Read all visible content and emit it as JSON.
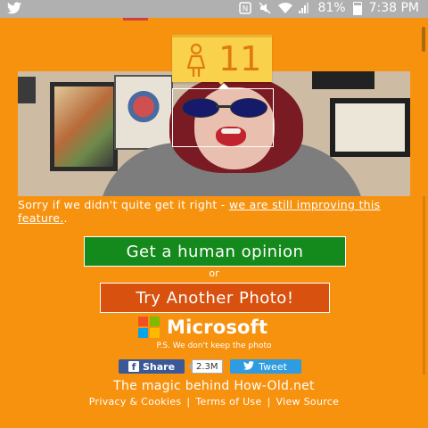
{
  "status_bar": {
    "icons": [
      "twitter-icon",
      "nfc-icon",
      "mute-icon",
      "wifi-icon",
      "signal-icon",
      "battery-icon"
    ],
    "battery_percent": "81%",
    "time": "7:38 PM"
  },
  "age_badge": {
    "gender_icon": "female-icon",
    "age": "11"
  },
  "message": {
    "text": "Sorry if we didn't quite get it right - ",
    "link_text": "we are still improving this feature.",
    "trailing": "."
  },
  "buttons": {
    "human_opinion": "Get a human opinion",
    "or_text": "or",
    "try_another": "Try Another Photo!"
  },
  "branding": {
    "company": "Microsoft",
    "logo_colors": [
      "#F25022",
      "#7FBA00",
      "#00A4EF",
      "#FFB900"
    ],
    "disclaimer": "P.S. We don't keep the photo"
  },
  "social": {
    "facebook_label": "Share",
    "facebook_count": "2.3M",
    "twitter_label": "Tweet"
  },
  "footer": {
    "tagline": "The magic behind How-Old.net",
    "links": [
      "Privacy & Cookies",
      "Terms of Use",
      "View Source"
    ]
  },
  "colors": {
    "background": "#F7920F",
    "human_button": "#138A1B",
    "try_button": "#D8510E",
    "badge": "#F9D14A",
    "facebook": "#3B5998",
    "twitter": "#2F9BE0"
  }
}
